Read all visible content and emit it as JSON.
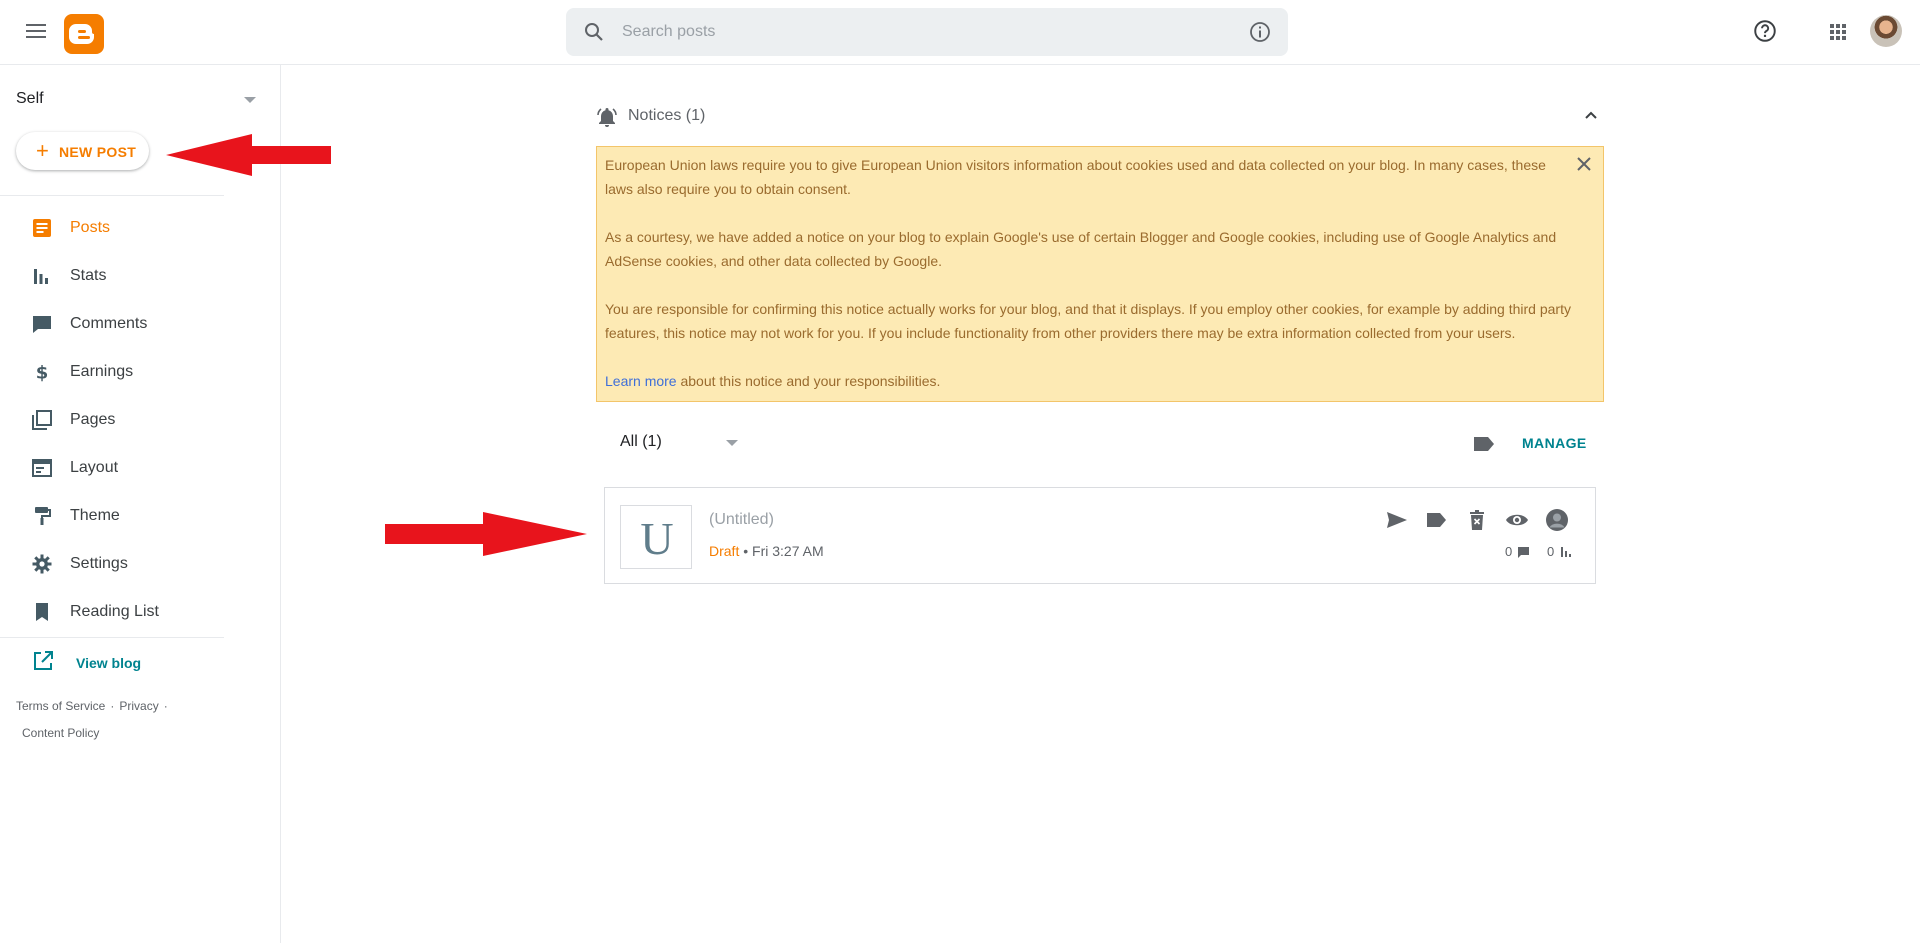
{
  "header": {
    "search_placeholder": "Search posts"
  },
  "sidebar": {
    "blog_name": "Self",
    "new_post_label": "NEW POST",
    "items": [
      {
        "label": "Posts",
        "icon": "posts-icon",
        "active": true
      },
      {
        "label": "Stats",
        "icon": "stats-icon",
        "active": false
      },
      {
        "label": "Comments",
        "icon": "comment-icon",
        "active": false
      },
      {
        "label": "Earnings",
        "icon": "dollar-icon",
        "active": false
      },
      {
        "label": "Pages",
        "icon": "pages-icon",
        "active": false
      },
      {
        "label": "Layout",
        "icon": "layout-icon",
        "active": false
      },
      {
        "label": "Theme",
        "icon": "paint-roller-icon",
        "active": false
      },
      {
        "label": "Settings",
        "icon": "gear-icon",
        "active": false
      },
      {
        "label": "Reading List",
        "icon": "bookmark-icon",
        "active": false
      }
    ],
    "view_blog_label": "View blog",
    "footer": {
      "terms": "Terms of Service",
      "privacy": "Privacy",
      "content_policy": "Content Policy"
    }
  },
  "notices": {
    "title": "Notices (1)",
    "paragraph1": "European Union laws require you to give European Union visitors information about cookies used and data collected on your blog. In many cases, these laws also require you to obtain consent.",
    "paragraph2": "As a courtesy, we have added a notice on your blog to explain Google's use of certain Blogger and Google cookies, including use of Google Analytics and AdSense cookies, and other data collected by Google.",
    "paragraph3": "You are responsible for confirming this notice actually works for your blog, and that it displays. If you employ other cookies, for example by adding third party features, this notice may not work for you. If you include functionality from other providers there may be extra information collected from your users.",
    "learn_more": "Learn more",
    "learn_more_suffix": " about this notice and your responsibilities."
  },
  "posts": {
    "filter_label": "All (1)",
    "manage_label": "MANAGE",
    "items": [
      {
        "thumb_letter": "U",
        "title": "(Untitled)",
        "status": "Draft",
        "date": " • Fri 3:27 AM",
        "comments": "0",
        "views": "0"
      }
    ]
  },
  "colors": {
    "accent": "#f57d00",
    "teal": "#00838f",
    "notice_bg": "#fdeab4",
    "annotation_arrow": "#e8141c"
  }
}
